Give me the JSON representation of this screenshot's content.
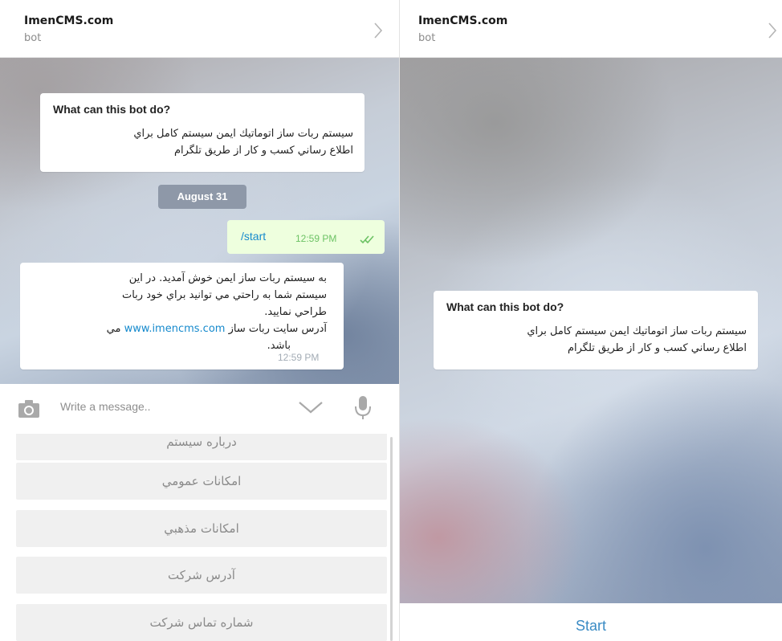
{
  "left": {
    "header": {
      "title": "ImenCMS.com",
      "subtitle": "bot"
    },
    "info_card": {
      "title": "What can this bot do?",
      "line1": "سيستم ربات ساز اتوماتيك ايمن سيستم كامل براي",
      "line2": "اطلاع رساني كسب و كار از طريق تلگرام"
    },
    "date_chip": "August 31",
    "outgoing": {
      "text": "/start",
      "time": "12:59 PM"
    },
    "incoming": {
      "line1": "به سيستم ربات ساز ايمن خوش آمديد. در اين",
      "line2": "سيستم شما به راحتي مي توانيد براي خود ربات",
      "line3": "طراحي نماييد.",
      "line4_before": "آدرس سايت ربات ساز ",
      "link": "www.imencms.com",
      "line4_after": " مي",
      "line5": "باشد.",
      "time": "12:59 PM"
    },
    "composer": {
      "placeholder": "Write a message.."
    },
    "keyboard": [
      "درباره سيستم",
      "امكانات عمومي",
      "امكانات مذهبي",
      "آدرس شركت",
      "شماره تماس شركت"
    ]
  },
  "right": {
    "header": {
      "title": "ImenCMS.com",
      "subtitle": "bot"
    },
    "info_card": {
      "title": "What can this bot do?",
      "line1": "سيستم ربات ساز اتوماتيك ايمن سيستم كامل براي",
      "line2": "اطلاع رساني كسب و كار از طريق تلگرام"
    },
    "start_button": "Start"
  },
  "icons": [
    "chevron-right-icon",
    "double-check-icon",
    "camera-icon",
    "chevron-down-icon",
    "microphone-icon"
  ],
  "colors": {
    "accent": "#168acd",
    "outgoing_bubble": "#eeffde",
    "check": "#6cc264",
    "date_chip": "#8e98a8"
  }
}
